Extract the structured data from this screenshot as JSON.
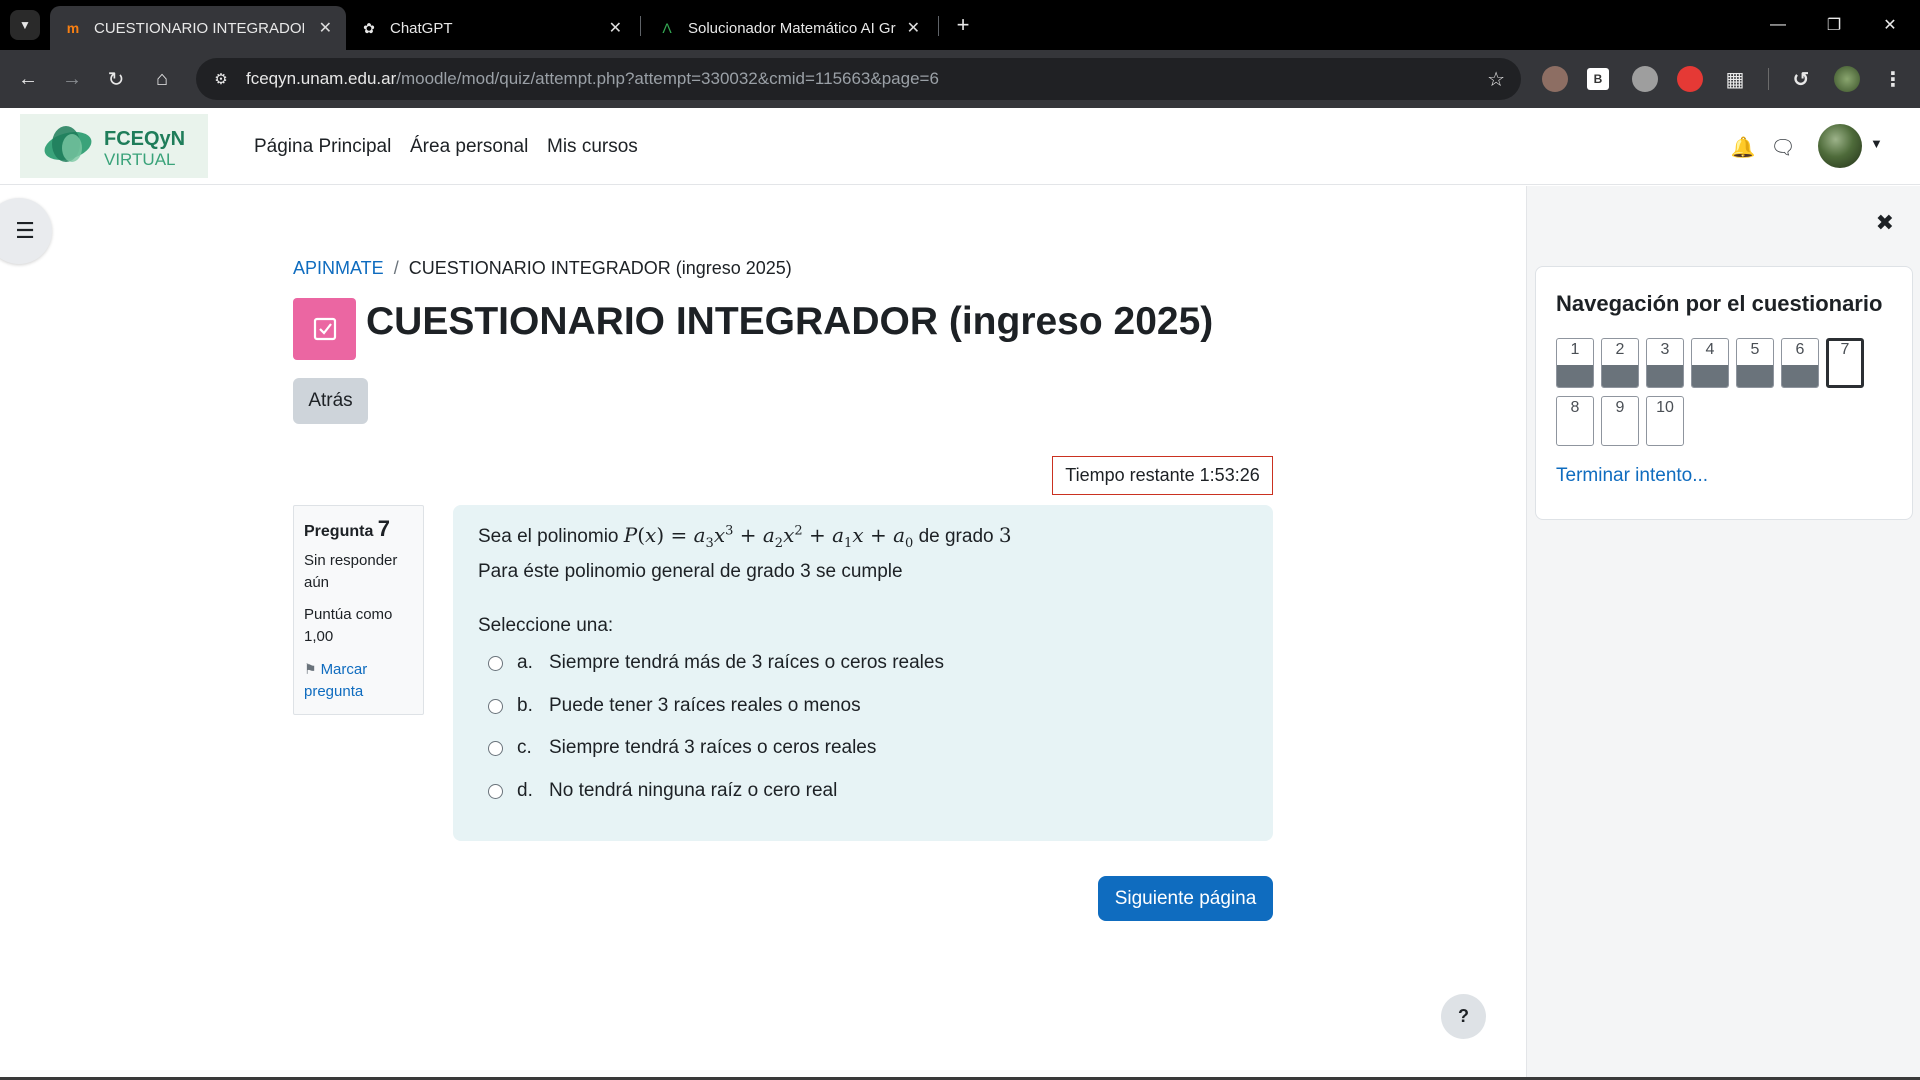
{
  "browser": {
    "tabs": [
      {
        "title": "CUESTIONARIO INTEGRADOR (i",
        "icon": "moodle-icon",
        "active": true
      },
      {
        "title": "ChatGPT",
        "icon": "chatgpt-icon",
        "active": false
      },
      {
        "title": "Solucionador Matemático AI Gr",
        "icon": "mathsolver-icon",
        "active": false
      }
    ],
    "url_host": "fceqyn.unam.edu.ar",
    "url_path": "/moodle/mod/quiz/attempt.php?attempt=330032&cmid=115663&page=6",
    "extensions": [
      {
        "label": "",
        "color": "#8d6e63"
      },
      {
        "label": "B",
        "color": "#ffffff"
      },
      {
        "label": "",
        "color": "#9e9e9e"
      },
      {
        "label": "",
        "color": "#e53935"
      }
    ]
  },
  "site": {
    "logo_text_1": "FCEQyN",
    "logo_text_2": "VIRTUAL",
    "nav": [
      "Página Principal",
      "Área personal",
      "Mis cursos"
    ]
  },
  "breadcrumb": {
    "course": "APINMATE",
    "current": "CUESTIONARIO INTEGRADOR (ingreso 2025)"
  },
  "page_title": "CUESTIONARIO INTEGRADOR (ingreso 2025)",
  "back_label": "Atrás",
  "timer": {
    "label": "Tiempo restante",
    "value": "1:53:26"
  },
  "question": {
    "label": "Pregunta",
    "number": "7",
    "state": "Sin responder aún",
    "grade": "Puntúa como 1,00",
    "flag": "Marcar pregunta",
    "text_intro": "Sea el polinomio",
    "text_tail": "de grado",
    "degree": "3",
    "text_2": "Para éste polinomio general de grado 3 se cumple",
    "prompt": "Seleccione una:",
    "answers": [
      {
        "letter": "a.",
        "text": "Siempre tendrá más de 3 raíces o ceros reales"
      },
      {
        "letter": "b.",
        "text": "Puede tener 3 raíces reales o menos"
      },
      {
        "letter": "c.",
        "text": "Siempre tendrá 3 raíces o ceros reales"
      },
      {
        "letter": "d.",
        "text": "No tendrá ninguna raíz o cero real"
      }
    ]
  },
  "next_label": "Siguiente página",
  "help_label": "?",
  "quiz_nav": {
    "title": "Navegación por el cuestionario",
    "buttons": [
      {
        "num": "1",
        "answered": true
      },
      {
        "num": "2",
        "answered": true
      },
      {
        "num": "3",
        "answered": true
      },
      {
        "num": "4",
        "answered": true
      },
      {
        "num": "5",
        "answered": true
      },
      {
        "num": "6",
        "answered": true
      },
      {
        "num": "7",
        "answered": false,
        "current": true
      },
      {
        "num": "8",
        "answered": false
      },
      {
        "num": "9",
        "answered": false
      },
      {
        "num": "10",
        "answered": false
      }
    ],
    "finish_label": "Terminar intento..."
  },
  "colors": {
    "primary": "#0f6cbf",
    "quiz_icon": "#eb66a2",
    "question_bg": "#e7f3f5",
    "timer_border": "#ca3120"
  }
}
